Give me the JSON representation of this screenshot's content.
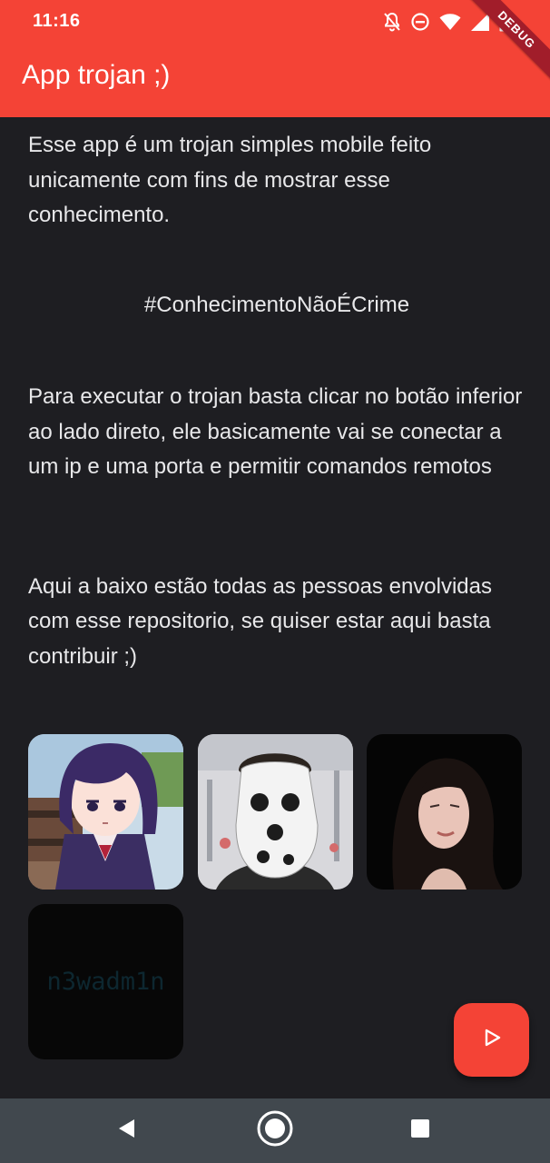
{
  "status_bar": {
    "time": "11:16",
    "icons": [
      "notifications-off-icon",
      "do-not-disturb-icon",
      "wifi-icon",
      "cellular-signal-icon",
      "battery-icon"
    ],
    "debug_banner": "DEBUG"
  },
  "app_bar": {
    "title": "App trojan ;)",
    "color": "#f44336"
  },
  "content": {
    "intro": "Esse app é um trojan simples mobile feito unicamente com fins de mostrar esse conhecimento.",
    "hashtag": "#ConhecimentoNãoÉCrime",
    "instructions": "Para executar o trojan basta clicar no botão inferior ao lado direto, ele basicamente vai se conectar a um ip e uma porta e permitir comandos remotos",
    "contributors_intro": "Aqui a baixo estão todas as pessoas envolvidas com esse repositorio, se quiser estar aqui basta contribuir ;)"
  },
  "contributors": [
    {
      "name": "contributor-1-avatar"
    },
    {
      "name": "contributor-2-avatar"
    },
    {
      "name": "contributor-3-avatar"
    },
    {
      "name": "contributor-4-avatar",
      "label": "n3wadm1n"
    }
  ],
  "fab": {
    "icon": "play-icon"
  },
  "nav_bar": {
    "buttons": [
      "back-icon",
      "home-icon",
      "recents-icon"
    ]
  }
}
